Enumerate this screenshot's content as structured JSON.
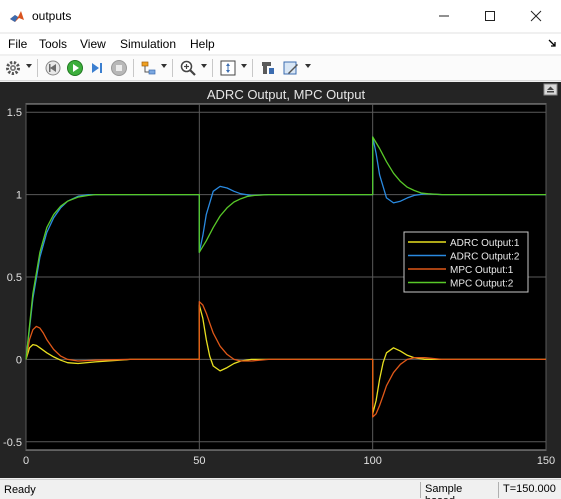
{
  "window": {
    "title": "outputs",
    "buttons": [
      "minimize",
      "maximize",
      "close"
    ]
  },
  "menu": [
    "File",
    "Tools",
    "View",
    "Simulation",
    "Help"
  ],
  "toolbar": {
    "icons": [
      "gear-icon",
      "step-back-icon",
      "run-icon",
      "step-forward-icon",
      "stop-icon",
      "highlight-icon",
      "zoom-icon",
      "autoscale-icon",
      "cursor-measure-icon",
      "style-icon"
    ]
  },
  "chart_data": {
    "type": "line",
    "title": "ADRC Output, MPC Output",
    "xlabel": "",
    "ylabel": "",
    "xlim": [
      0,
      150
    ],
    "ylim": [
      -0.55,
      1.55
    ],
    "xticks": [
      0,
      50,
      100,
      150
    ],
    "yticks": [
      -0.5,
      0,
      0.5,
      1,
      1.5
    ],
    "grid": true,
    "legend_position": "right",
    "background": "#000000",
    "series": [
      {
        "name": "ADRC Output:1",
        "color": "#e8e020",
        "x": [
          0,
          1,
          2,
          3,
          4,
          6,
          8,
          10,
          12,
          15,
          20,
          30,
          50,
          50,
          51,
          52,
          53,
          54,
          56,
          58,
          60,
          62,
          65,
          70,
          80,
          100,
          100,
          101,
          102,
          103,
          104,
          106,
          108,
          110,
          112,
          115,
          120,
          130,
          150
        ],
        "values": [
          0,
          0.07,
          0.09,
          0.085,
          0.07,
          0.04,
          0.015,
          -0.005,
          -0.02,
          -0.025,
          -0.015,
          0,
          0,
          0.33,
          0.25,
          0.12,
          0.02,
          -0.04,
          -0.07,
          -0.05,
          -0.025,
          -0.01,
          0,
          0,
          0,
          0,
          -0.33,
          -0.25,
          -0.12,
          -0.02,
          0.04,
          0.07,
          0.05,
          0.025,
          0.01,
          0,
          0,
          0,
          0
        ]
      },
      {
        "name": "ADRC Output:2",
        "color": "#2a8ae0",
        "x": [
          0,
          2,
          4,
          6,
          8,
          10,
          12,
          15,
          18,
          20,
          25,
          30,
          40,
          50,
          50,
          51,
          52,
          54,
          56,
          58,
          60,
          62,
          65,
          70,
          80,
          100,
          100,
          101,
          102,
          104,
          106,
          108,
          110,
          112,
          115,
          120,
          130,
          150
        ],
        "values": [
          0,
          0.37,
          0.62,
          0.77,
          0.86,
          0.92,
          0.96,
          0.99,
          1.0,
          1.0,
          1.0,
          1.0,
          1.0,
          1.0,
          0.65,
          0.75,
          0.88,
          1.02,
          1.05,
          1.04,
          1.02,
          1.005,
          0.995,
          1.0,
          1.0,
          1.0,
          1.35,
          1.25,
          1.12,
          0.98,
          0.95,
          0.96,
          0.98,
          0.995,
          1.005,
          1.0,
          1.0,
          1.0
        ]
      },
      {
        "name": "MPC Output:1",
        "color": "#e05818",
        "x": [
          0,
          1,
          2,
          3,
          4,
          5,
          6,
          8,
          10,
          12,
          15,
          20,
          30,
          50,
          50,
          51,
          52,
          53,
          54,
          56,
          58,
          60,
          62,
          65,
          70,
          80,
          100,
          100,
          101,
          102,
          103,
          104,
          106,
          108,
          110,
          112,
          115,
          120,
          130,
          150
        ],
        "values": [
          0,
          0.12,
          0.18,
          0.2,
          0.19,
          0.16,
          0.12,
          0.06,
          0.02,
          0.0,
          -0.01,
          -0.005,
          0,
          0,
          0.35,
          0.33,
          0.28,
          0.22,
          0.16,
          0.08,
          0.03,
          0.0,
          -0.01,
          -0.01,
          0,
          0,
          0,
          -0.35,
          -0.33,
          -0.28,
          -0.22,
          -0.16,
          -0.08,
          -0.03,
          0.0,
          0.01,
          0.01,
          0,
          0,
          0
        ]
      },
      {
        "name": "MPC Output:2",
        "color": "#58c828",
        "x": [
          0,
          2,
          4,
          6,
          8,
          10,
          12,
          15,
          18,
          20,
          25,
          30,
          40,
          50,
          50,
          52,
          54,
          56,
          58,
          60,
          62,
          64,
          66,
          70,
          80,
          100,
          100,
          102,
          104,
          106,
          108,
          110,
          112,
          114,
          116,
          120,
          130,
          150
        ],
        "values": [
          0,
          0.4,
          0.65,
          0.8,
          0.88,
          0.93,
          0.96,
          0.985,
          0.995,
          1.0,
          1.0,
          1.0,
          1.0,
          1.0,
          0.65,
          0.72,
          0.8,
          0.87,
          0.92,
          0.955,
          0.975,
          0.99,
          0.995,
          1.0,
          1.0,
          1.0,
          1.35,
          1.28,
          1.2,
          1.13,
          1.08,
          1.045,
          1.025,
          1.01,
          1.005,
          1.0,
          1.0,
          1.0
        ]
      }
    ]
  },
  "status": {
    "left": "Ready",
    "mode": "Sample based",
    "time": "T=150.000"
  }
}
